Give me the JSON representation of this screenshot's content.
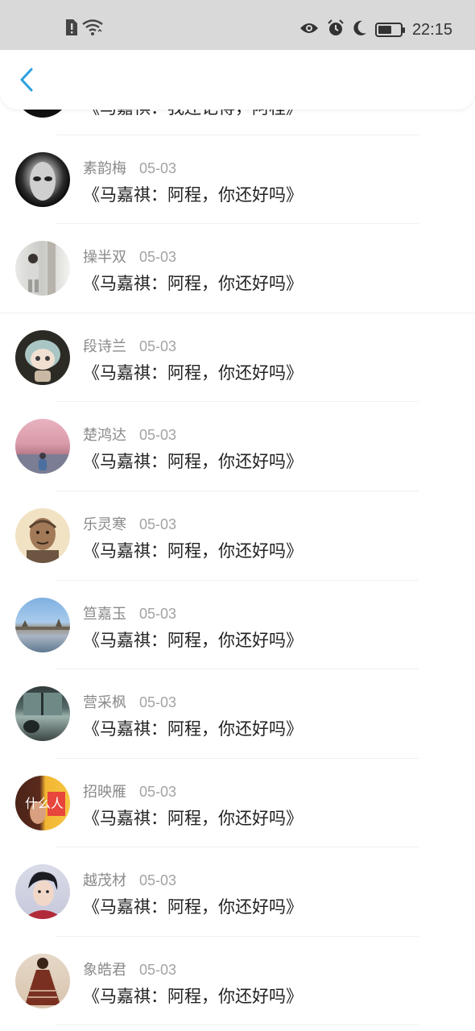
{
  "status_bar": {
    "time": "22:15",
    "left_icons": [
      "sim-alert-icon",
      "wifi-icon"
    ],
    "right_icons": [
      "eye-icon",
      "alarm-icon",
      "moon-icon",
      "battery-icon"
    ],
    "battery_level": 0.6
  },
  "header": {
    "back_icon": "chevron-left-icon",
    "accent_color": "#2aa1e0"
  },
  "list": {
    "partial_item": {
      "title": "《马嘉祺：我还记得，阿程》"
    },
    "items": [
      {
        "name": "素韵梅",
        "date": "05-03",
        "title": "《马嘉祺：阿程，你还好吗》",
        "avatar": "mask-avatar"
      },
      {
        "name": "操半双",
        "date": "05-03",
        "title": "《马嘉祺：阿程，你还好吗》",
        "avatar": "person-wall-avatar"
      },
      {
        "name": "段诗兰",
        "date": "05-03",
        "title": "《马嘉祺：阿程，你还好吗》",
        "avatar": "doll-avatar"
      },
      {
        "name": "楚鸿达",
        "date": "05-03",
        "title": "《马嘉祺：阿程，你还好吗》",
        "avatar": "pink-sky-avatar"
      },
      {
        "name": "乐灵寒",
        "date": "05-03",
        "title": "《马嘉祺：阿程，你还好吗》",
        "avatar": "old-man-avatar"
      },
      {
        "name": "笪嘉玉",
        "date": "05-03",
        "title": "《马嘉祺：阿程，你还好吗》",
        "avatar": "lake-avatar"
      },
      {
        "name": "营采枫",
        "date": "05-03",
        "title": "《马嘉祺：阿程，你还好吗》",
        "avatar": "dark-window-avatar"
      },
      {
        "name": "招映雁",
        "date": "05-03",
        "title": "《马嘉祺：阿程，你还好吗》",
        "avatar": "yellow-portrait-avatar",
        "avatar_text": "什么人"
      },
      {
        "name": "越茂材",
        "date": "05-03",
        "title": "《马嘉祺：阿程，你还好吗》",
        "avatar": "young-man-avatar"
      },
      {
        "name": "象皓君",
        "date": "05-03",
        "title": "《马嘉祺：阿程，你还好吗》",
        "avatar": "dress-avatar"
      }
    ]
  }
}
